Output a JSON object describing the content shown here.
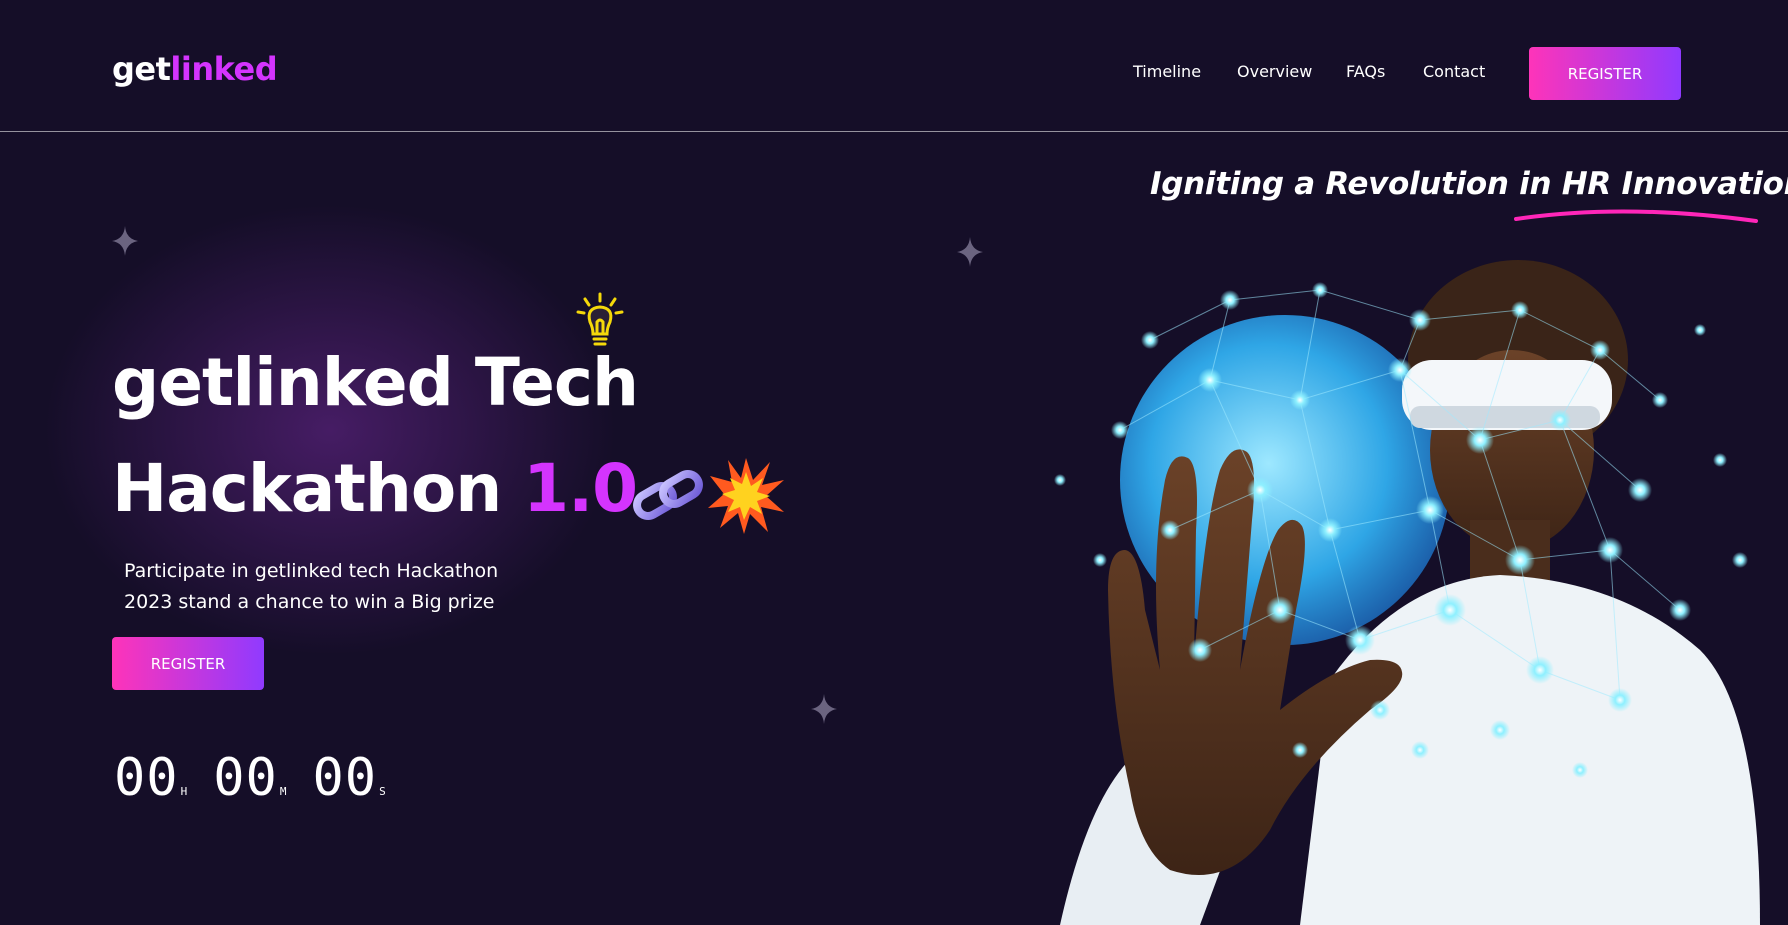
{
  "header": {
    "logo_part1": "get",
    "logo_part2": "linked",
    "nav": [
      "Timeline",
      "Overview",
      "FAQs",
      "Contact"
    ],
    "register_label": "REGISTER"
  },
  "hero": {
    "tagline": "Igniting a Revolution in HR Innovation",
    "title_line1": "getlinked Tech",
    "title_line2_prefix": "Hackathon ",
    "title_line2_accent": "1.0",
    "description_line1": "Participate in getlinked tech Hackathon",
    "description_line2": "2023 stand a chance to win a Big prize",
    "register_label": "REGISTER",
    "countdown": {
      "hours": "00",
      "hours_unit": "H",
      "minutes": "00",
      "minutes_unit": "M",
      "seconds": "00",
      "seconds_unit": "S"
    }
  },
  "colors": {
    "background": "#150e28",
    "accent": "#d434fe",
    "button_gradient_start": "#fe34b9",
    "button_gradient_end": "#903aff"
  },
  "icons": [
    "lightbulb-icon",
    "chain-link-icon",
    "explosion-icon",
    "sparkle-star-icon"
  ]
}
